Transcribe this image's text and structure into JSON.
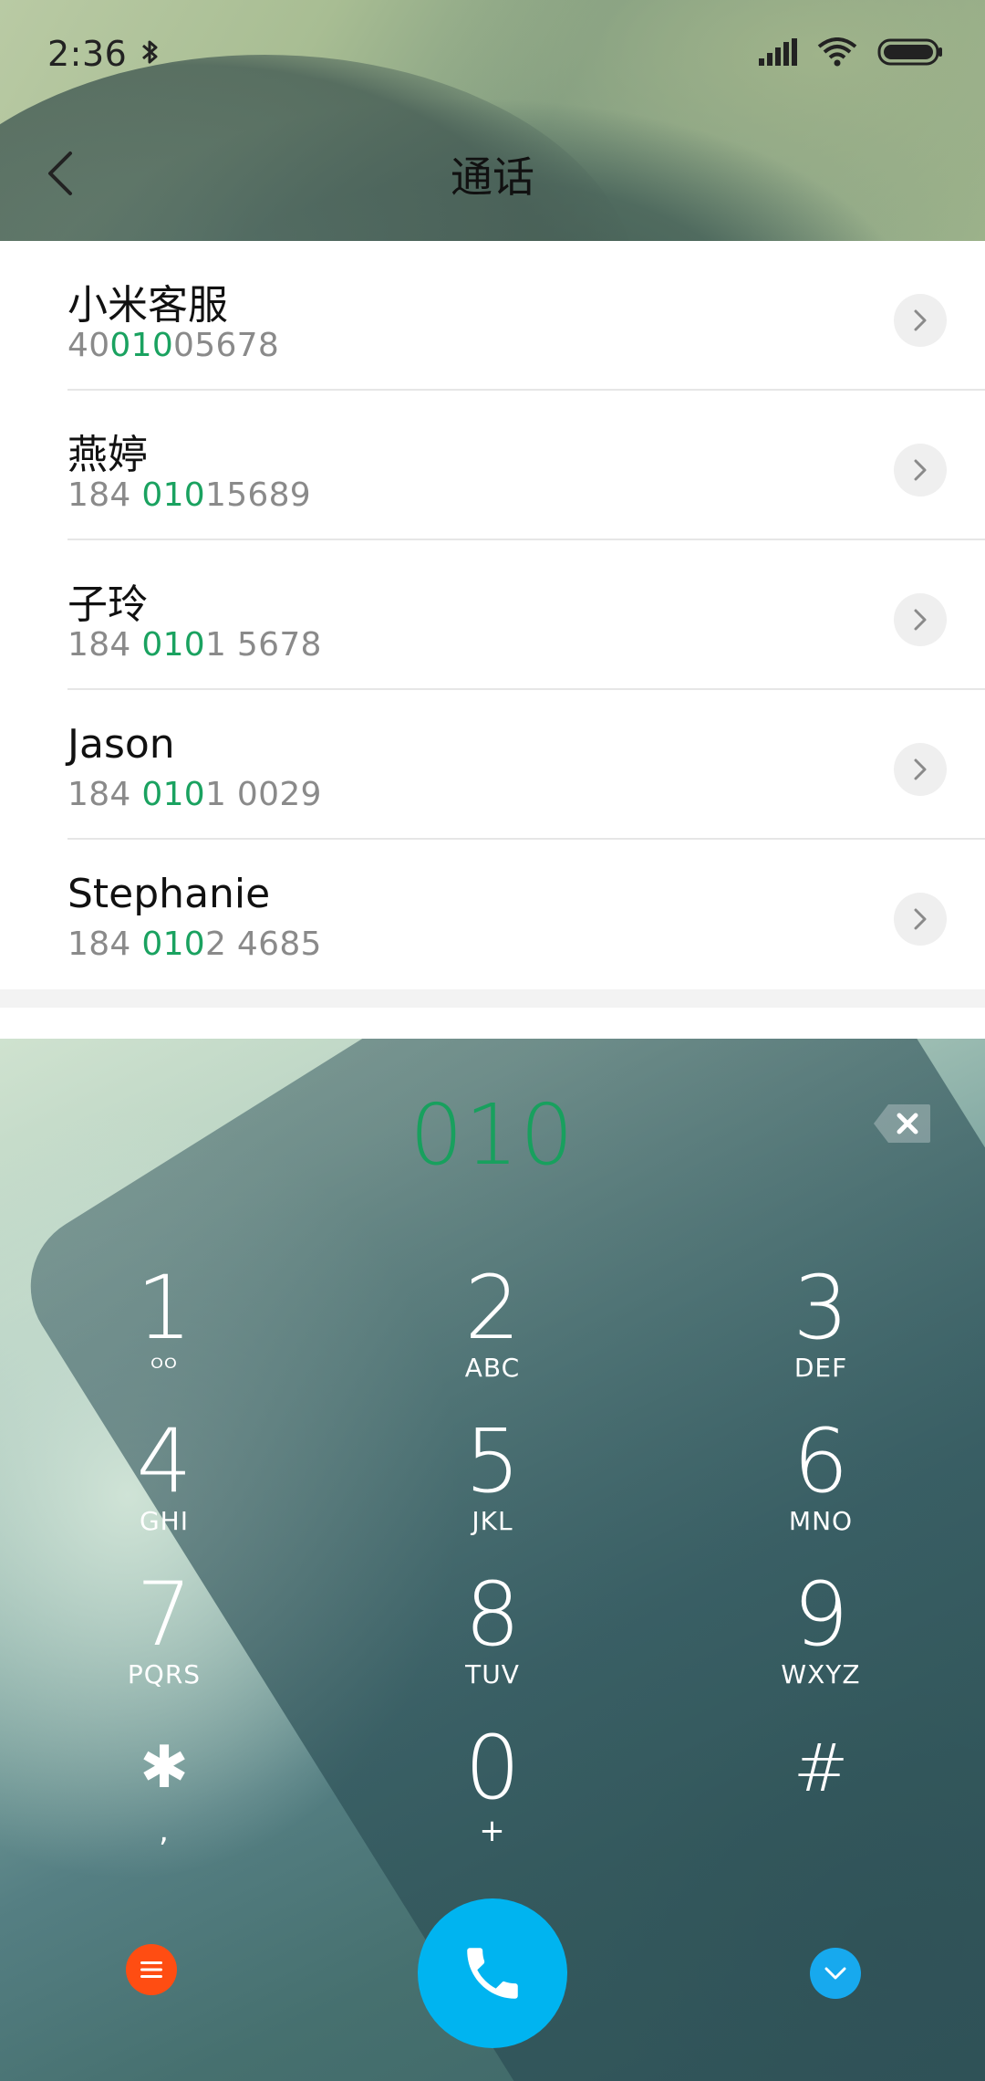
{
  "status_bar": {
    "time": "2:36",
    "icons": [
      "bluetooth-icon",
      "signal-icon",
      "wifi-icon",
      "battery-icon"
    ]
  },
  "header": {
    "title": "通话",
    "back_icon": "chevron-left-icon"
  },
  "contacts": [
    {
      "name": "小米客服",
      "number_parts": [
        "40",
        "010",
        "05678"
      ]
    },
    {
      "name": "燕婷",
      "number_parts": [
        "184 ",
        "010",
        "15689"
      ]
    },
    {
      "name": "子玲",
      "number_parts": [
        "184 ",
        "010",
        "1 5678"
      ]
    },
    {
      "name": "Jason",
      "number_parts": [
        "184 ",
        "010",
        "1 0029"
      ]
    },
    {
      "name": "Stephanie",
      "number_parts": [
        "184 ",
        "010",
        "2 4685"
      ]
    }
  ],
  "dialer": {
    "input": "010",
    "colors": {
      "digits": "#18a05e",
      "call_button": "#00b4f0",
      "menu_button": "#ff4d12",
      "collapse_button": "#17a9ee"
    },
    "keys": [
      {
        "num": "1",
        "letters": "ᴼᴼ"
      },
      {
        "num": "2",
        "letters": "ABC"
      },
      {
        "num": "3",
        "letters": "DEF"
      },
      {
        "num": "4",
        "letters": "GHI"
      },
      {
        "num": "5",
        "letters": "JKL"
      },
      {
        "num": "6",
        "letters": "MNO"
      },
      {
        "num": "7",
        "letters": "PQRS"
      },
      {
        "num": "8",
        "letters": "TUV"
      },
      {
        "num": "9",
        "letters": "WXYZ"
      },
      {
        "num": "✱",
        "letters": ","
      },
      {
        "num": "0",
        "letters": "+"
      },
      {
        "num": "#",
        "letters": ""
      }
    ]
  }
}
